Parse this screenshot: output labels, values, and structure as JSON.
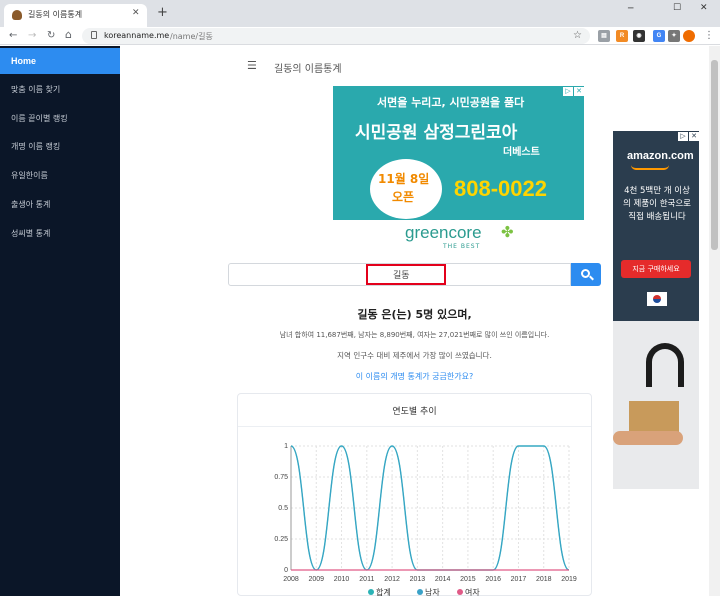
{
  "browser": {
    "tab_title": "길동의 이름통계",
    "new_tab": "+",
    "url_host": "koreanname.me",
    "url_path": "/name/길동",
    "win_min": "─",
    "win_max": "☐",
    "win_close": "✕",
    "ext_badges": [
      "",
      ""
    ]
  },
  "sidebar": {
    "items": [
      {
        "label": "Home",
        "active": true
      },
      {
        "label": "맞춤 이름 찾기"
      },
      {
        "label": "이름 끝이별 랭킹"
      },
      {
        "label": "개명 이름 랭킹"
      },
      {
        "label": "유일한이름"
      },
      {
        "label": "출생아 통계"
      },
      {
        "label": "성씨별 통계"
      }
    ]
  },
  "header": {
    "menu_icon": "☰",
    "title": "길동의 이름통계"
  },
  "ad_top": {
    "line1": "서면을 누리고, 시민공원을 품다",
    "line2": "시민공원 삼정그린코아",
    "line3": "더베스트",
    "date_line1": "11월 8일",
    "date_line2": "오픈",
    "phone": "808-0022",
    "brand": "greencore",
    "brand_sub": "THE BEST"
  },
  "ad_right": {
    "brand": "amazon.com",
    "text": "4천 5백만 개 이상의 제품이 한국으로 직접 배송됩니다",
    "cta": "지금 구매하세요"
  },
  "search": {
    "value": "길동",
    "button_icon": "search-icon"
  },
  "result": {
    "headline": "길동 은(는) 5명 있으며,",
    "line1": "남녀 합하여 11,687번째, 남자는 8,890번째, 여자는 27,021번째로 많이 쓰인 이름입니다.",
    "line2": "지역 인구수 대비 제주에서 가장 많이 쓰였습니다.",
    "link": "이 이름의 개명 통계가 궁금한가요?"
  },
  "card": {
    "title": "연도별 추이"
  },
  "colors": {
    "sidebar_bg": "#0b1628",
    "accent": "#2d8cf0",
    "line_total": "#2bb3b6",
    "line_female": "#e05a87",
    "highlight": "#e3001b"
  },
  "chart_data": {
    "type": "line",
    "x": [
      2008,
      2009,
      2010,
      2011,
      2012,
      2013,
      2014,
      2015,
      2016,
      2017,
      2018,
      2019
    ],
    "x_tick_labels": [
      "2008",
      "2009",
      "2010",
      "2011",
      "2012",
      "2013",
      "2014",
      "2015",
      "2016",
      "2017",
      "2018",
      "2019"
    ],
    "y_tick_labels": [
      "0",
      "0.25",
      "0.5",
      "0.75",
      "1"
    ],
    "ylim": [
      0,
      1
    ],
    "grid": true,
    "series": [
      {
        "name": "합계",
        "values": [
          1,
          0,
          1,
          0,
          1,
          0,
          0,
          0,
          0,
          1,
          1,
          0
        ]
      },
      {
        "name": "남자",
        "values": [
          1,
          0,
          1,
          0,
          1,
          0,
          0,
          0,
          0,
          1,
          1,
          0
        ]
      },
      {
        "name": "여자",
        "values": [
          0,
          0,
          0,
          0,
          0,
          0,
          0,
          0,
          0,
          0,
          0,
          0
        ]
      }
    ],
    "legend_position": "bottom"
  }
}
